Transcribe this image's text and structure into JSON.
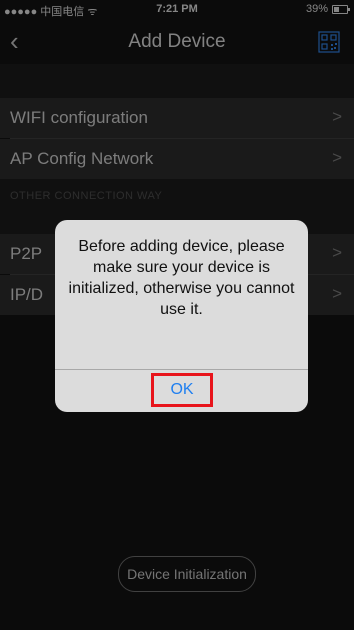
{
  "status_bar": {
    "carrier": "●●●●● 中国电信 ᯤ",
    "time": "7:21 PM",
    "battery": "39%",
    "battery_level": 0.39
  },
  "nav": {
    "back_icon": "‹",
    "title": "Add Device",
    "scan_icon": "qr-scan-icon"
  },
  "group1": [
    {
      "label": "WIFI configuration",
      "chevron": ">"
    },
    {
      "label": "AP Config Network",
      "chevron": ">"
    }
  ],
  "group2_header": "OTHER CONNECTION WAY",
  "group2": [
    {
      "label": "P2P",
      "chevron": ">"
    },
    {
      "label": "IP/D",
      "chevron": ">"
    }
  ],
  "alert": {
    "message": "Before adding device, please make sure your device is initialized, otherwise you cannot use it.",
    "ok_label": "OK"
  },
  "bottom_button": "Device Initialization",
  "colors": {
    "background": "#131313",
    "row": "#2a2a2a",
    "alert_bg": "#dcdcdc",
    "ok_text": "#1f7ff0",
    "highlight": "#e8141b"
  }
}
